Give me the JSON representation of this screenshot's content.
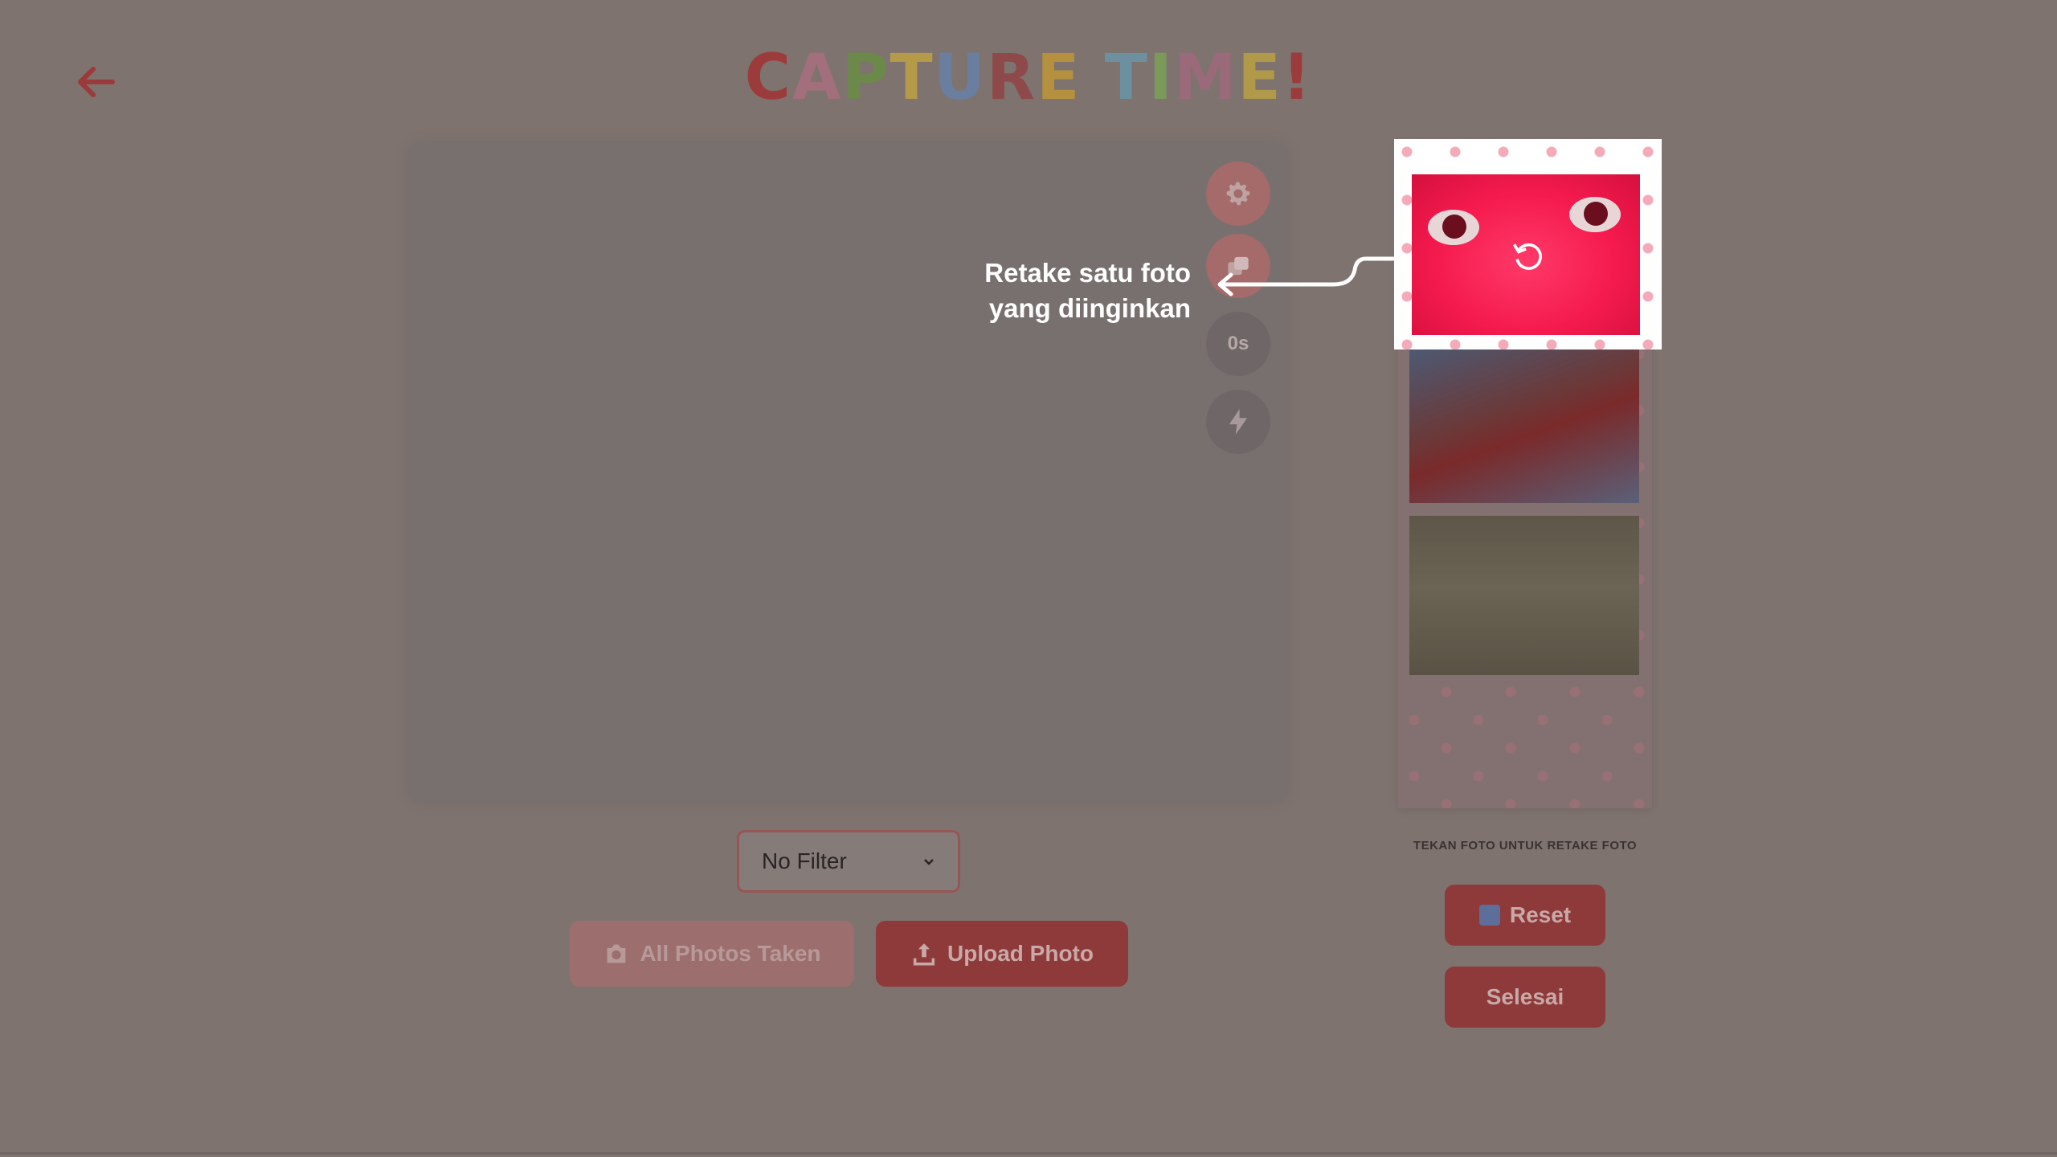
{
  "header": {
    "back_icon": "arrow-left-icon",
    "title_letters": [
      {
        "ch": "C",
        "color": "#9c3b3b"
      },
      {
        "ch": "A",
        "color": "#a36f7c"
      },
      {
        "ch": "P",
        "color": "#6b8a4a"
      },
      {
        "ch": "T",
        "color": "#b59a4a"
      },
      {
        "ch": "U",
        "color": "#6a7ea0"
      },
      {
        "ch": "R",
        "color": "#8e4a4a"
      },
      {
        "ch": "E",
        "color": "#b5913f"
      },
      {
        "ch": " ",
        "color": "#000000"
      },
      {
        "ch": "T",
        "color": "#6c90a0"
      },
      {
        "ch": "I",
        "color": "#7a9a5a"
      },
      {
        "ch": "M",
        "color": "#9a6a7a"
      },
      {
        "ch": "E",
        "color": "#b09a4a"
      },
      {
        "ch": "!",
        "color": "#9c3b3b"
      }
    ]
  },
  "camera_tools": {
    "settings_icon": "gear-icon",
    "switch_icon": "camera-switch-icon",
    "timer_label": "0s",
    "flash_icon": "lightning-icon"
  },
  "callout": {
    "line1": "Retake satu foto",
    "line2": "yang diinginkan"
  },
  "filter": {
    "selected": "No Filter"
  },
  "actions": {
    "all_taken_label": "All Photos Taken",
    "upload_label": "Upload Photo"
  },
  "strip": {
    "hint": "TEKAN FOTO UNTUK RETAKE FOTO",
    "reset_label": "Reset",
    "done_label": "Selesai"
  },
  "colors": {
    "accent": "#8f3a3a",
    "overlay": "#7f736f",
    "highlight_photo": "#f51a4e"
  }
}
